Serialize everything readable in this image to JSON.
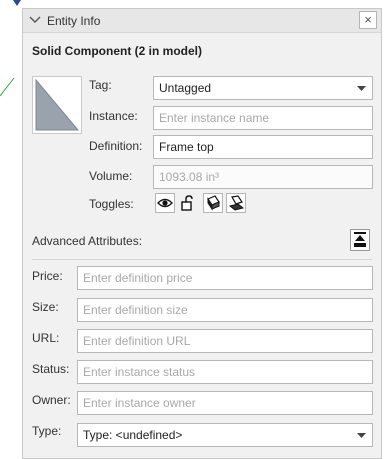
{
  "panel": {
    "title": "Entity Info",
    "close_label": "×"
  },
  "component": {
    "heading": "Solid Component (2 in model)"
  },
  "fields": {
    "tag": {
      "label": "Tag:",
      "value": "Untagged"
    },
    "instance": {
      "label": "Instance:",
      "placeholder": "Enter instance name"
    },
    "definition": {
      "label": "Definition:",
      "value": "Frame top"
    },
    "volume": {
      "label": "Volume:",
      "value": "1093.08 in³"
    },
    "toggles": {
      "label": "Toggles:",
      "icons": [
        "eye-icon",
        "unlock-icon",
        "cast-shadows-icon",
        "receive-shadows-icon"
      ]
    }
  },
  "advanced": {
    "label": "Advanced Attributes:",
    "price": {
      "label": "Price:",
      "placeholder": "Enter definition price"
    },
    "size": {
      "label": "Size:",
      "placeholder": "Enter definition size"
    },
    "url": {
      "label": "URL:",
      "placeholder": "Enter definition URL"
    },
    "status": {
      "label": "Status:",
      "placeholder": "Enter instance status"
    },
    "owner": {
      "label": "Owner:",
      "placeholder": "Enter instance owner"
    },
    "type": {
      "label": "Type:",
      "value": "Type: <undefined>"
    }
  },
  "colors": {
    "panel_bg": "#f1f1f1",
    "header_bg": "#e7e7e7",
    "field_border": "#b7b7b7",
    "placeholder": "#a8a8a8",
    "canvas_axis": "#3aa53a"
  }
}
